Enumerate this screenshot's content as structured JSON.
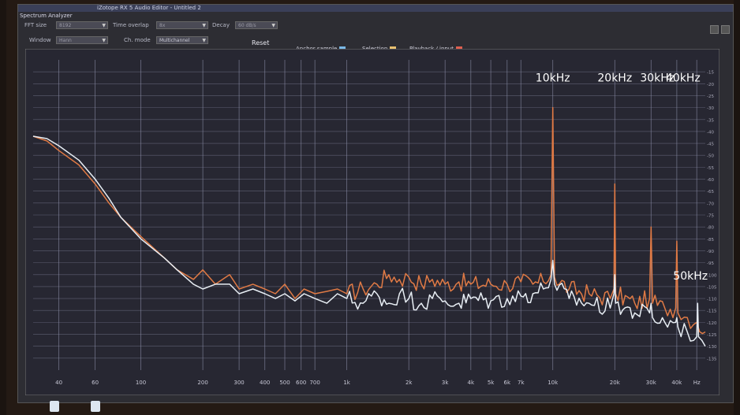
{
  "window": {
    "title": "iZotope RX 5 Audio Editor - Untitled 2",
    "panel_title": "Spectrum Analyzer"
  },
  "controls": {
    "fft_size_label": "FFT size",
    "fft_size_value": "8192",
    "time_overlap_label": "Time overlap",
    "time_overlap_value": "8x",
    "decay_label": "Decay",
    "decay_value": "60 dB/s",
    "window_label": "Window",
    "window_value": "Hann",
    "ch_mode_label": "Ch. mode",
    "ch_mode_value": "Multichannel",
    "reset_label": "Reset"
  },
  "legend": {
    "anchor": "Anchor sample",
    "selection": "Selection",
    "playback": "Playback / input"
  },
  "colors": {
    "orange_trace": "#e07a45",
    "white_trace": "#e8eef4",
    "grid": "#8c8ea8",
    "plot_bg": "#2a2a34"
  },
  "annotations": [
    "10kHz",
    "20kHz",
    "30kHz",
    "40kHz",
    "50kHz"
  ],
  "chart_data": {
    "type": "line",
    "x_scale": "log",
    "xlim": [
      30,
      55000
    ],
    "x_tick_labels": [
      {
        "f": 40,
        "label": "40"
      },
      {
        "f": 60,
        "label": "60"
      },
      {
        "f": 100,
        "label": "100"
      },
      {
        "f": 200,
        "label": "200"
      },
      {
        "f": 300,
        "label": "300"
      },
      {
        "f": 400,
        "label": "400"
      },
      {
        "f": 500,
        "label": "500"
      },
      {
        "f": 600,
        "label": "600"
      },
      {
        "f": 700,
        "label": "700"
      },
      {
        "f": 1000,
        "label": "1k"
      },
      {
        "f": 2000,
        "label": "2k"
      },
      {
        "f": 3000,
        "label": "3k"
      },
      {
        "f": 4000,
        "label": "4k"
      },
      {
        "f": 5000,
        "label": "5k"
      },
      {
        "f": 6000,
        "label": "6k"
      },
      {
        "f": 7000,
        "label": "7k"
      },
      {
        "f": 10000,
        "label": "10k"
      },
      {
        "f": 20000,
        "label": "20k"
      },
      {
        "f": 30000,
        "label": "30k"
      },
      {
        "f": 40000,
        "label": "40k"
      },
      {
        "f": 50000,
        "label": "Hz"
      }
    ],
    "y_unit": "dB",
    "ylim": [
      -140,
      -10
    ],
    "y_tick_labels": [
      {
        "v": -15,
        "label": "-15"
      },
      {
        "v": -20,
        "label": "-20"
      },
      {
        "v": -25,
        "label": "-25"
      },
      {
        "v": -30,
        "label": "-30"
      },
      {
        "v": -35,
        "label": "-35"
      },
      {
        "v": -40,
        "label": "-40"
      },
      {
        "v": -45,
        "label": "-45"
      },
      {
        "v": -50,
        "label": "-50"
      },
      {
        "v": -55,
        "label": "-55"
      },
      {
        "v": -60,
        "label": "-60"
      },
      {
        "v": -65,
        "label": "-65"
      },
      {
        "v": -70,
        "label": "-70"
      },
      {
        "v": -75,
        "label": "-75"
      },
      {
        "v": -80,
        "label": "-80"
      },
      {
        "v": -85,
        "label": "-85"
      },
      {
        "v": -90,
        "label": "-90"
      },
      {
        "v": -95,
        "label": "-95"
      },
      {
        "v": -100,
        "label": "-100"
      },
      {
        "v": -105,
        "label": "-105"
      },
      {
        "v": -110,
        "label": "-110"
      },
      {
        "v": -115,
        "label": "-115"
      },
      {
        "v": -120,
        "label": "-120"
      },
      {
        "v": -125,
        "label": "-125"
      },
      {
        "v": -130,
        "label": "-130"
      },
      {
        "v": -135,
        "label": "-135"
      }
    ],
    "series": [
      {
        "color": "#e07a45",
        "points": [
          [
            30,
            -42
          ],
          [
            35,
            -44
          ],
          [
            40,
            -48
          ],
          [
            50,
            -54
          ],
          [
            60,
            -62
          ],
          [
            70,
            -70
          ],
          [
            80,
            -76
          ],
          [
            100,
            -84
          ],
          [
            130,
            -93
          ],
          [
            150,
            -98
          ],
          [
            180,
            -102
          ],
          [
            200,
            -98
          ],
          [
            230,
            -104
          ],
          [
            270,
            -100
          ],
          [
            300,
            -106
          ],
          [
            350,
            -104
          ],
          [
            400,
            -106
          ],
          [
            450,
            -108
          ],
          [
            500,
            -104
          ],
          [
            560,
            -110
          ],
          [
            620,
            -106
          ],
          [
            700,
            -108
          ],
          [
            800,
            -107
          ],
          [
            900,
            -106
          ],
          [
            1000,
            -108
          ],
          [
            1200,
            -106
          ],
          [
            1400,
            -104
          ],
          [
            1600,
            -100
          ],
          [
            1800,
            -102
          ],
          [
            2000,
            -101
          ],
          [
            2300,
            -104
          ],
          [
            2600,
            -102
          ],
          [
            3000,
            -104
          ],
          [
            3500,
            -103
          ],
          [
            4000,
            -104
          ],
          [
            5000,
            -104
          ],
          [
            6000,
            -104
          ],
          [
            7000,
            -103
          ],
          [
            8000,
            -104
          ],
          [
            9000,
            -103
          ],
          [
            9800,
            -100
          ],
          [
            10000,
            -30
          ],
          [
            10200,
            -101
          ],
          [
            12000,
            -106
          ],
          [
            15000,
            -108
          ],
          [
            19000,
            -110
          ],
          [
            19800,
            -106
          ],
          [
            20000,
            -62
          ],
          [
            20200,
            -108
          ],
          [
            25000,
            -112
          ],
          [
            29500,
            -110
          ],
          [
            30000,
            -80
          ],
          [
            30500,
            -112
          ],
          [
            35000,
            -114
          ],
          [
            39500,
            -114
          ],
          [
            40000,
            -86
          ],
          [
            40500,
            -116
          ],
          [
            45000,
            -118
          ],
          [
            50000,
            -120
          ],
          [
            55000,
            -124
          ]
        ]
      },
      {
        "color": "#e8eef4",
        "points": [
          [
            30,
            -42
          ],
          [
            35,
            -43
          ],
          [
            40,
            -46
          ],
          [
            50,
            -52
          ],
          [
            60,
            -60
          ],
          [
            70,
            -68
          ],
          [
            80,
            -76
          ],
          [
            100,
            -85
          ],
          [
            130,
            -93
          ],
          [
            150,
            -98
          ],
          [
            180,
            -104
          ],
          [
            200,
            -106
          ],
          [
            230,
            -104
          ],
          [
            270,
            -104
          ],
          [
            300,
            -108
          ],
          [
            350,
            -106
          ],
          [
            400,
            -108
          ],
          [
            450,
            -110
          ],
          [
            500,
            -108
          ],
          [
            560,
            -111
          ],
          [
            620,
            -108
          ],
          [
            700,
            -110
          ],
          [
            800,
            -112
          ],
          [
            900,
            -108
          ],
          [
            1000,
            -110
          ],
          [
            1200,
            -112
          ],
          [
            1400,
            -108
          ],
          [
            1600,
            -112
          ],
          [
            1800,
            -108
          ],
          [
            2000,
            -110
          ],
          [
            2300,
            -112
          ],
          [
            2600,
            -110
          ],
          [
            3000,
            -111
          ],
          [
            3500,
            -112
          ],
          [
            4000,
            -110
          ],
          [
            5000,
            -111
          ],
          [
            6000,
            -110
          ],
          [
            7000,
            -109
          ],
          [
            8000,
            -108
          ],
          [
            9000,
            -106
          ],
          [
            9800,
            -102
          ],
          [
            10000,
            -94
          ],
          [
            10200,
            -104
          ],
          [
            12000,
            -110
          ],
          [
            15000,
            -112
          ],
          [
            19000,
            -114
          ],
          [
            19800,
            -108
          ],
          [
            20000,
            -100
          ],
          [
            20200,
            -112
          ],
          [
            25000,
            -116
          ],
          [
            29500,
            -116
          ],
          [
            30000,
            -112
          ],
          [
            30500,
            -118
          ],
          [
            35000,
            -120
          ],
          [
            39500,
            -120
          ],
          [
            40000,
            -118
          ],
          [
            40500,
            -122
          ],
          [
            45000,
            -124
          ],
          [
            50000,
            -126
          ],
          [
            50500,
            -112
          ],
          [
            51000,
            -126
          ],
          [
            55000,
            -130
          ]
        ]
      }
    ]
  }
}
